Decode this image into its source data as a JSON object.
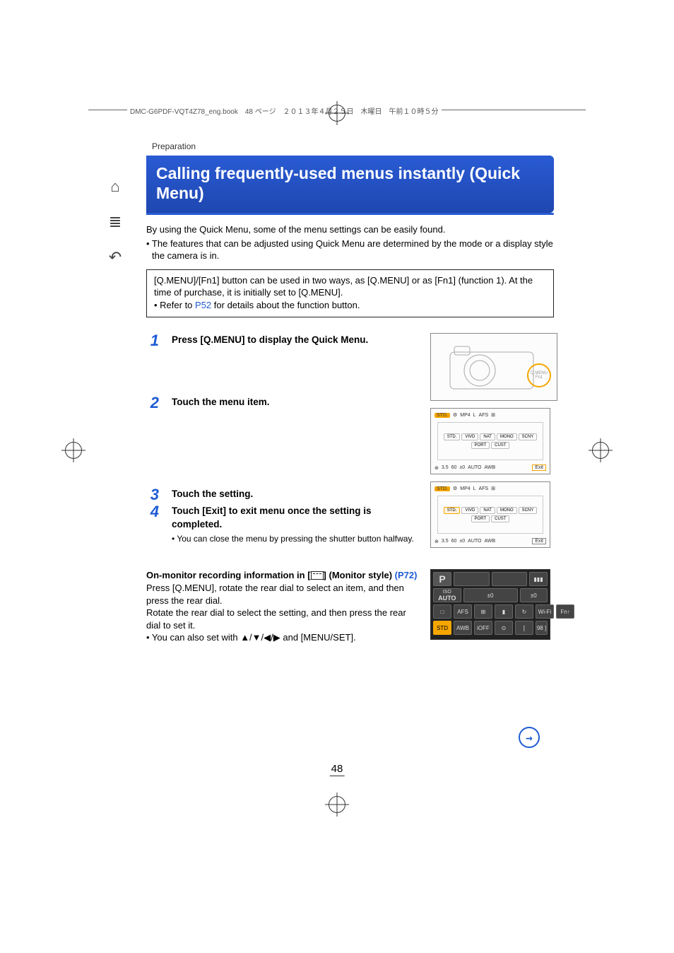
{
  "header": {
    "running": "DMC-G6PDF-VQT4Z78_eng.book　48 ページ　２０１３年４月２５日　木曜日　午前１０時５分"
  },
  "breadcrumb": "Preparation",
  "title": "Calling frequently-used menus instantly (Quick Menu)",
  "intro": {
    "line1": "By using the Quick Menu, some of the menu settings can be easily found.",
    "line2": "• The features that can be adjusted using Quick Menu are determined by the mode or a display style the camera is in."
  },
  "info_box": {
    "line1": "[Q.MENU]/[Fn1] button can be used in two ways, as [Q.MENU] or as [Fn1] (function 1). At the time of purchase, it is initially set to [Q.MENU].",
    "line2_prefix": "• Refer to ",
    "line2_link": "P52",
    "line2_suffix": " for details about the function button."
  },
  "steps": {
    "s1_num": "1",
    "s1_title": "Press [Q.MENU] to display the Quick Menu.",
    "s2_num": "2",
    "s2_title": "Touch the menu item.",
    "s3_num": "3",
    "s3_title": "Touch the setting.",
    "s4_num": "4",
    "s4_title": "Touch [Exit] to exit menu once the setting is completed.",
    "s4_note": "• You can close the menu by pressing the shutter button halfway."
  },
  "camera_callout": {
    "label_top": "Q.MENU",
    "label_bottom": "Fn1"
  },
  "lcd_fig_a": {
    "top_icons": [
      "STD.",
      "⚙",
      "MP4",
      "L",
      "AFS",
      "⊞"
    ],
    "options_row1": [
      "STD.",
      "VIVD",
      "NAT",
      "MONO"
    ],
    "options_row2": [
      "SCNY",
      "PORT",
      "CUST"
    ],
    "bottom": [
      "⊛",
      "3.5",
      "60",
      "±0",
      "AUTO",
      "AWB"
    ],
    "exit": "Exit"
  },
  "lcd_fig_b": {
    "top_icons": [
      "STD.",
      "⚙",
      "MP4",
      "L",
      "AFS",
      "⊞"
    ],
    "options_row1": [
      "STD.",
      "VIVD",
      "NAT",
      "MONO"
    ],
    "options_row2": [
      "SCNY",
      "PORT",
      "CUST"
    ],
    "selected": "STD.",
    "bottom": [
      "⊛",
      "3.5",
      "60",
      "±0",
      "AUTO",
      "AWB"
    ],
    "exit": "Exit"
  },
  "monitor": {
    "title_prefix": "On-monitor recording information in [",
    "title_suffix": "] (Monitor style) ",
    "link": "(P72)",
    "para1": "Press [Q.MENU], rotate the rear dial to select an item, and then press the rear dial.",
    "para2": "Rotate the rear dial to select the setting, and then press the rear dial to set it.",
    "para3": "• You can also set with ▲/▼/◀/▶ and [MENU/SET]."
  },
  "monitor_panel": {
    "row1": [
      "P",
      "",
      "",
      "▮▮▮"
    ],
    "row2_a": "ISO",
    "row2_b": "±0",
    "row2_c": "±0",
    "row2_auto": "AUTO",
    "row3": [
      "□",
      "AFS",
      "⊞",
      "▮",
      "↻",
      "Wi-Fi",
      "Fn↑"
    ],
    "row4": [
      "STD",
      "AWB",
      "iOFF",
      "⊙",
      "[",
      "98 ]"
    ]
  },
  "page_number": "48",
  "sidebar": {
    "home": "⌂",
    "menu": "≣",
    "back": "↶"
  }
}
